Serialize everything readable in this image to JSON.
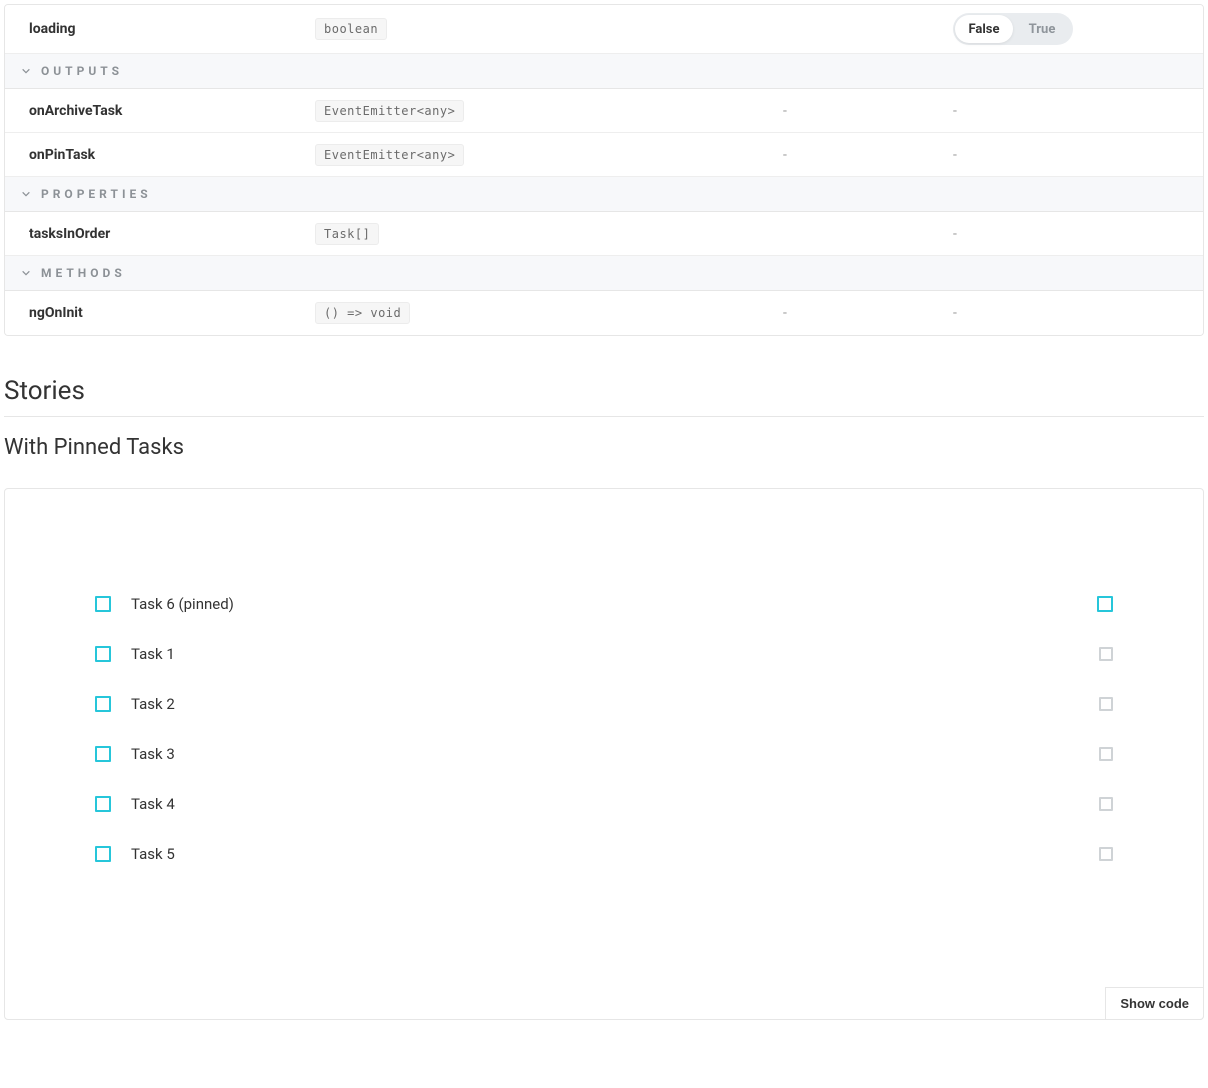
{
  "args": {
    "inputs": [
      {
        "name": "loading",
        "type": "boolean",
        "default": "",
        "control": {
          "kind": "boolean-toggle",
          "value": false,
          "false_label": "False",
          "true_label": "True"
        }
      }
    ],
    "sections": [
      {
        "label": "OUTPUTS",
        "rows": [
          {
            "name": "onArchiveTask",
            "type": "EventEmitter<any>",
            "default": "-",
            "control": "-"
          },
          {
            "name": "onPinTask",
            "type": "EventEmitter<any>",
            "default": "-",
            "control": "-"
          }
        ]
      },
      {
        "label": "PROPERTIES",
        "rows": [
          {
            "name": "tasksInOrder",
            "type": "Task[]",
            "default": "",
            "control": "-"
          }
        ]
      },
      {
        "label": "METHODS",
        "rows": [
          {
            "name": "ngOnInit",
            "type": "() => void",
            "default": "-",
            "control": "-"
          }
        ]
      }
    ]
  },
  "stories": {
    "heading": "Stories",
    "story_title": "With Pinned Tasks",
    "show_code_label": "Show code",
    "tasks": [
      {
        "title": "Task 6 (pinned)",
        "pinned": true
      },
      {
        "title": "Task 1",
        "pinned": false
      },
      {
        "title": "Task 2",
        "pinned": false
      },
      {
        "title": "Task 3",
        "pinned": false
      },
      {
        "title": "Task 4",
        "pinned": false
      },
      {
        "title": "Task 5",
        "pinned": false
      }
    ]
  }
}
